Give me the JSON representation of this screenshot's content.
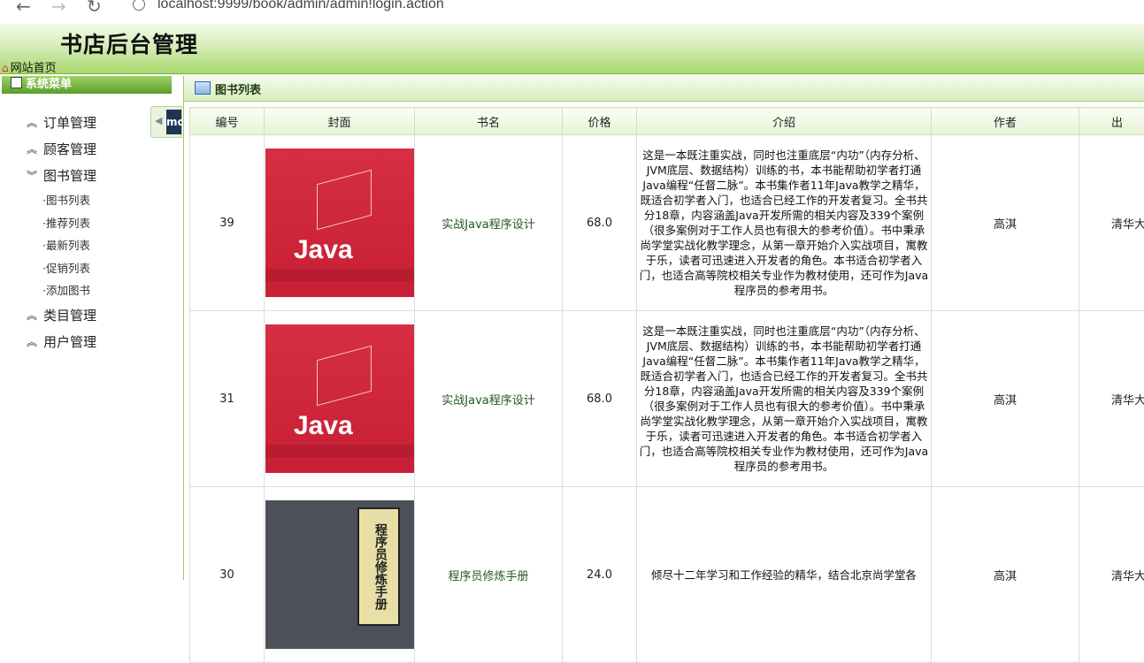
{
  "browser": {
    "url": "localhost:9999/book/admin/admin!login.action"
  },
  "app": {
    "title": "书店后台管理",
    "home_link": "网站首页"
  },
  "menu": {
    "header": "系统菜单",
    "groups": [
      {
        "label": "订单管理",
        "icon": "chevron-up-icon"
      },
      {
        "label": "顾客管理",
        "icon": "chevron-up-icon"
      },
      {
        "label": "图书管理",
        "icon": "chevron-down-icon",
        "items": [
          "图书列表",
          "推荐列表",
          "最新列表",
          "促销列表",
          "添加图书"
        ]
      },
      {
        "label": "类目管理",
        "icon": "chevron-up-icon"
      },
      {
        "label": "用户管理",
        "icon": "chevron-up-icon"
      }
    ]
  },
  "panel": {
    "title": "图书列表",
    "columns": [
      "编号",
      "封面",
      "书名",
      "价格",
      "介绍",
      "作者",
      "出"
    ],
    "rows": [
      {
        "id": "39",
        "name": "实战Java程序设计",
        "price": "68.0",
        "desc": "这是一本既注重实战，同时也注重底层“内功”（内存分析、JVM底层、数据结构）训练的书，本书能帮助初学者打通Java编程“任督二脉”。本书集作者11年Java教学之精华，既适合初学者入门，也适合已经工作的开发者复习。全书共分18章，内容涵盖Java开发所需的相关内容及339个案例（很多案例对于工作人员也有很大的参考价值）。书中秉承尚学堂实战化教学理念，从第一章开始介入实战项目，寓教于乐，读者可迅速进入开发者的角色。本书适合初学者入门，也适合高等院校相关专业作为教材使用，还可作为Java程序员的参考用书。",
        "author": "高淇",
        "publisher": "清华大",
        "cover": "java-book-cover"
      },
      {
        "id": "31",
        "name": "实战Java程序设计",
        "price": "68.0",
        "desc": "这是一本既注重实战，同时也注重底层“内功”（内存分析、JVM底层、数据结构）训练的书，本书能帮助初学者打通Java编程“任督二脉”。本书集作者11年Java教学之精华，既适合初学者入门，也适合已经工作的开发者复习。全书共分18章，内容涵盖Java开发所需的相关内容及339个案例（很多案例对于工作人员也有很大的参考价值）。书中秉承尚学堂实战化教学理念，从第一章开始介入实战项目，寓教于乐，读者可迅速进入开发者的角色。本书适合初学者入门，也适合高等院校相关专业作为教材使用，还可作为Java程序员的参考用书。",
        "author": "高淇",
        "publisher": "清华大",
        "cover": "java-book-cover"
      },
      {
        "id": "30",
        "name": "程序员修炼手册",
        "price": "24.0",
        "desc": "倾尽十二年学习和工作经验的精华，结合北京尚学堂各",
        "author": "高淇",
        "publisher": "清华大",
        "cover": "programmer-book-cover"
      }
    ]
  },
  "cover_text": {
    "java_big": "Java",
    "programmer": "程序员修炼手册"
  },
  "colors": {
    "header_green": "#a9d86d",
    "menu_head": "#5a9d2a",
    "link_green": "#1f5a1f"
  }
}
